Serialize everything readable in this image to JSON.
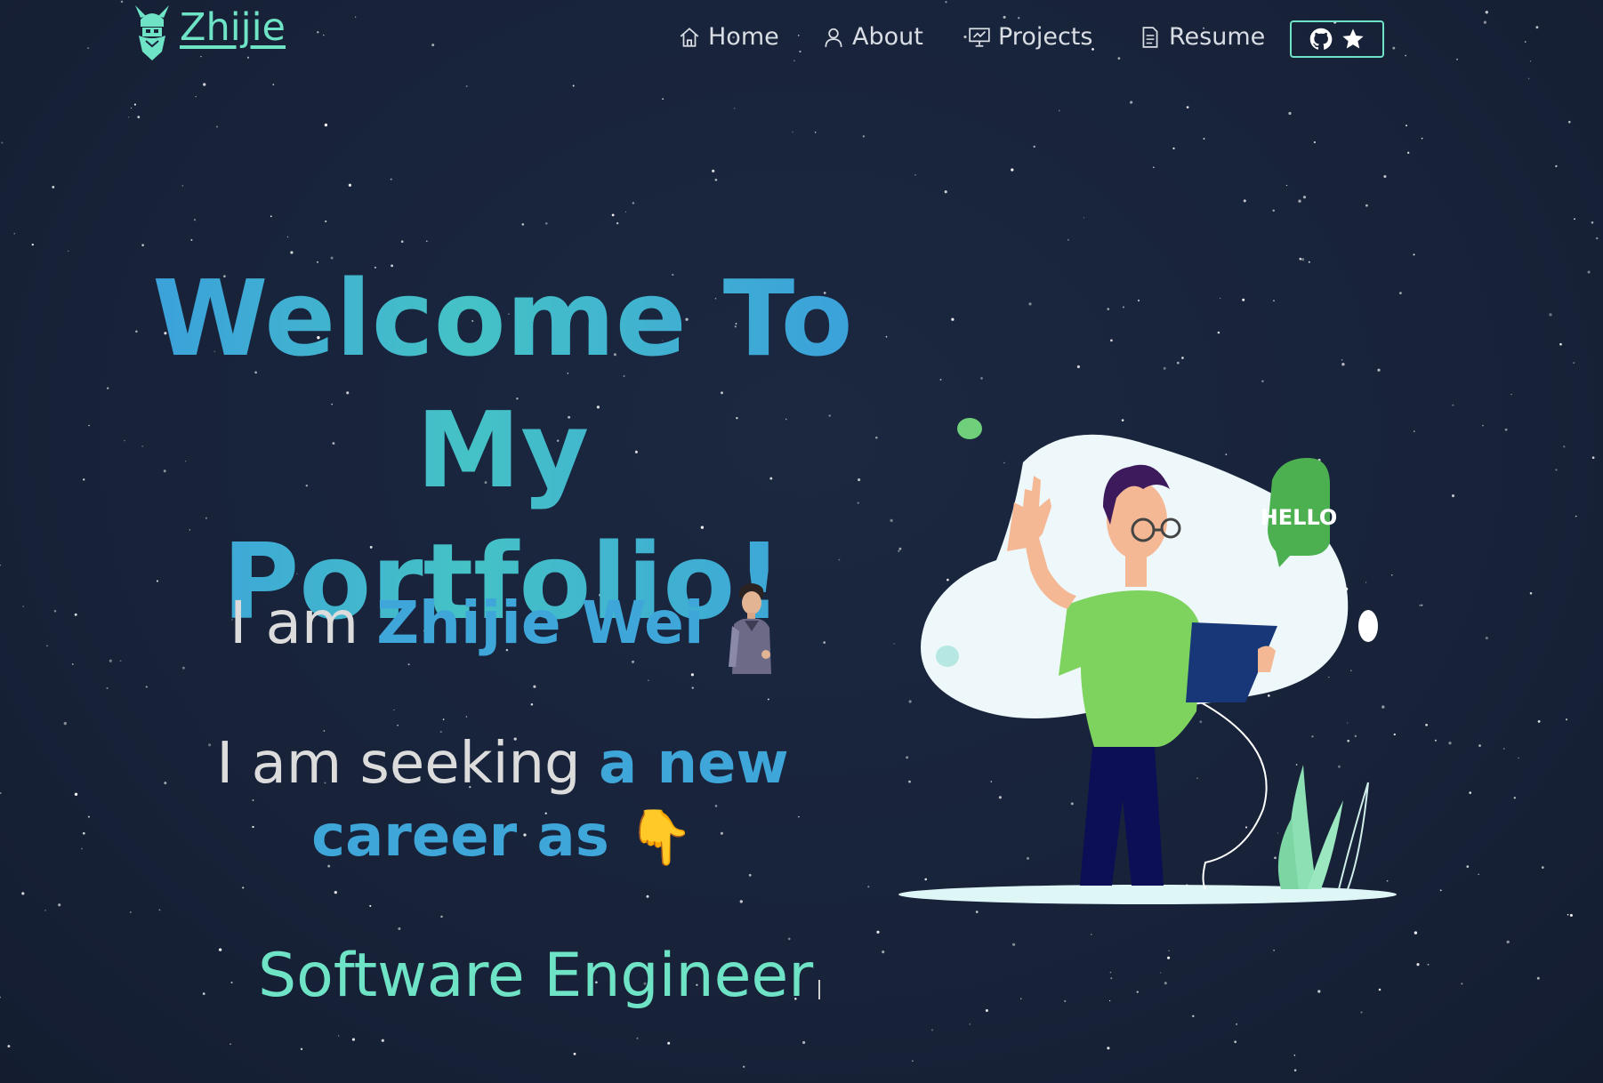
{
  "brand": {
    "name": "Zhijie",
    "logo_icon": "viking-logo-icon"
  },
  "nav": {
    "items": [
      {
        "label": "Home",
        "icon": "home-icon"
      },
      {
        "label": "About",
        "icon": "user-icon"
      },
      {
        "label": "Projects",
        "icon": "presentation-icon"
      },
      {
        "label": "Resume",
        "icon": "document-icon"
      }
    ],
    "github_button": {
      "icons": [
        "github-icon",
        "star-icon"
      ]
    }
  },
  "hero": {
    "title_line1": "Welcome To",
    "title_line2": "My Portfolio!",
    "intro_prefix": "I am",
    "intro_name": "Zhijie Wei",
    "seeking_prefix": "I am seeking",
    "seeking_highlight_1": "a new",
    "seeking_highlight_2": "career as",
    "pointing_emoji": "👇",
    "typed_role": "Software Engineer",
    "bubble_text": "HELLO"
  },
  "colors": {
    "background": "#18233a",
    "accent_teal": "#6fe3c6",
    "accent_blue": "#3fa6d9",
    "shirt_green": "#7dd35e",
    "bubble_green": "#4caf50"
  }
}
